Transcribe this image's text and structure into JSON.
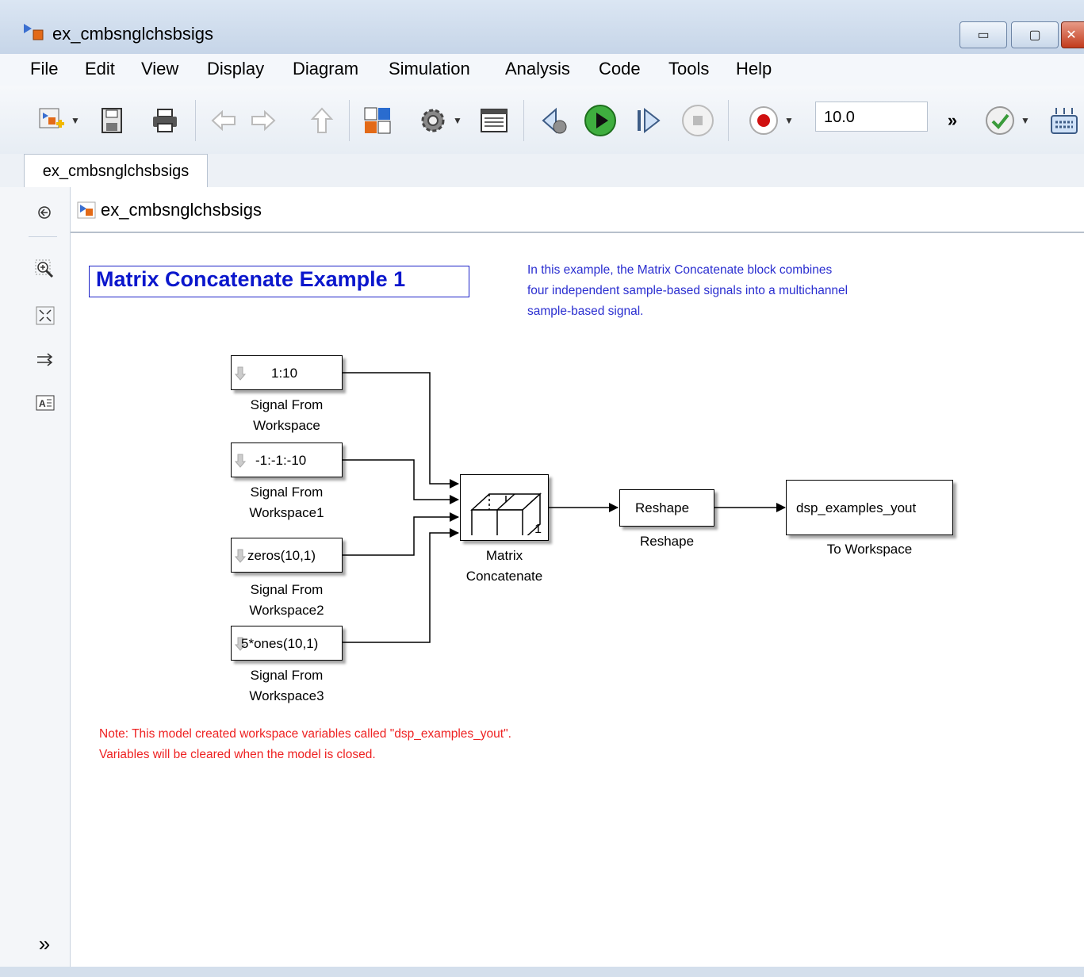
{
  "window": {
    "title": "ex_cmbsnglchsbsigs",
    "controls": {
      "minimize": "▭",
      "maximize": "▢",
      "close": "✕"
    }
  },
  "menu": [
    "File",
    "Edit",
    "View",
    "Display",
    "Diagram",
    "Simulation",
    "Analysis",
    "Code",
    "Tools",
    "Help"
  ],
  "toolbar": {
    "stop_time": "10.0",
    "more": "»",
    "buttons": [
      "new-model-icon",
      "save-icon",
      "print-icon",
      "back-arrow-icon",
      "forward-arrow-icon",
      "up-arrow-icon",
      "library-browser-icon",
      "model-config-gear-icon",
      "model-explorer-icon",
      "step-back-icon",
      "run-icon",
      "step-forward-icon",
      "stop-icon",
      "record-icon",
      "model-advisor-check-icon",
      "build-icon"
    ]
  },
  "tab": {
    "label": "ex_cmbsnglchsbsigs"
  },
  "addressbar": {
    "path": "ex_cmbsnglchsbsigs"
  },
  "palette": {
    "buttons": [
      "navigate-back-icon",
      "zoom-in-icon",
      "fit-to-view-icon",
      "port-arrow-icon",
      "annotation-icon"
    ],
    "expand": "»"
  },
  "canvas": {
    "title": "Matrix Concatenate Example 1",
    "description": [
      "In this example, the Matrix Concatenate block combines",
      "four independent sample-based signals into a multichannel",
      "sample-based signal."
    ],
    "note": [
      "Note: This model created workspace variables called \"dsp_examples_yout\".",
      "Variables will be cleared when the model is closed."
    ],
    "blocks": {
      "sfw": {
        "value": "1:10",
        "label1": "Signal From",
        "label2": "Workspace"
      },
      "sfw1": {
        "value": "-1:-1:-10",
        "label1": "Signal From",
        "label2": "Workspace1"
      },
      "sfw2": {
        "value": "zeros(10,1)",
        "label1": "Signal From",
        "label2": "Workspace2"
      },
      "sfw3": {
        "value": "5*ones(10,1)",
        "label1": "Signal From",
        "label2": "Workspace3"
      },
      "concat": {
        "dim": "1",
        "label1": "Matrix",
        "label2": "Concatenate"
      },
      "reshape": {
        "value": "Reshape",
        "label": "Reshape"
      },
      "toworkspace": {
        "value": "dsp_examples_yout",
        "label": "To Workspace"
      }
    }
  },
  "colors": {
    "title_blue": "#0b17cc",
    "desc_blue": "#2a2ed0",
    "note_red": "#ee2222"
  }
}
